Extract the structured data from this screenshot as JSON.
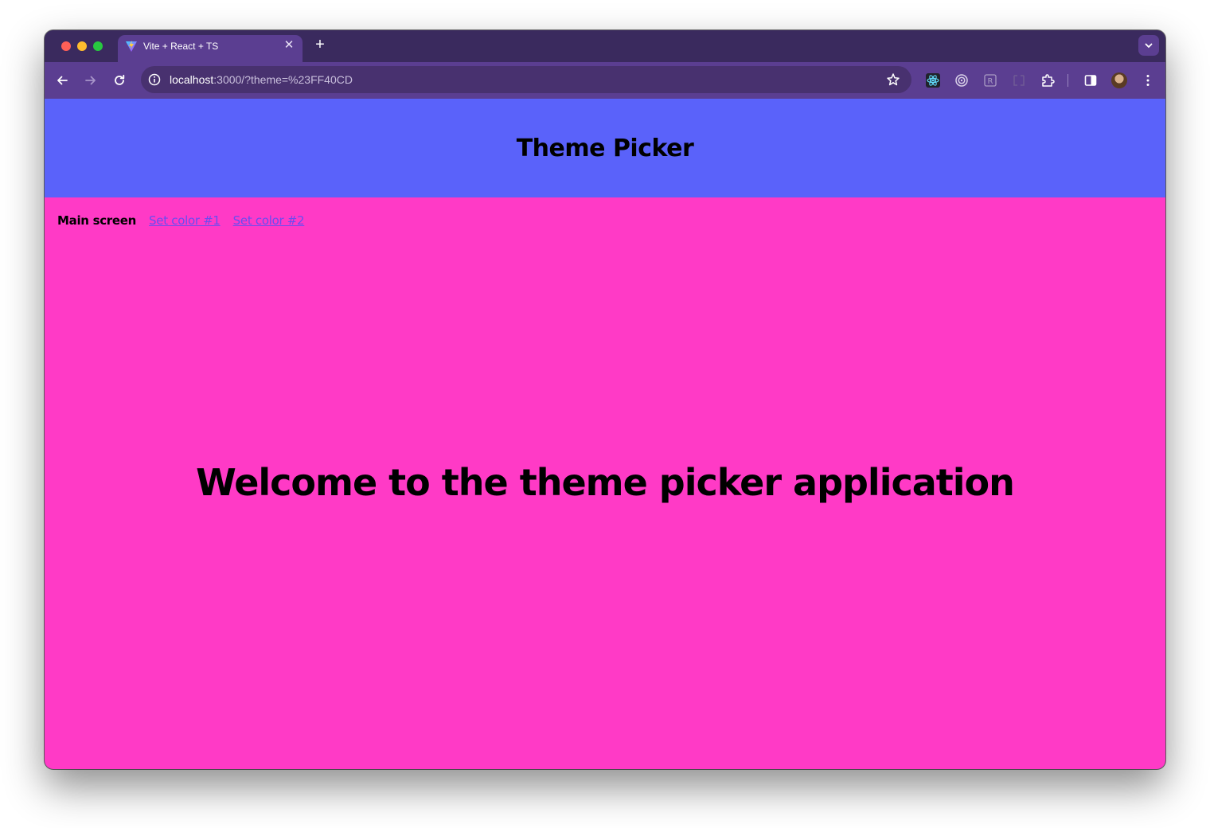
{
  "browser": {
    "tab": {
      "title": "Vite + React + TS",
      "favicon": "vite-logo-icon"
    },
    "url": {
      "host": "localhost",
      "rest": ":3000/?theme=%23FF40CD"
    },
    "colors": {
      "frame": "#3a2a5e",
      "toolbar": "#5b3e91",
      "omnibox": "#48316f"
    }
  },
  "app": {
    "title": "Theme Picker",
    "nav": {
      "current": "Main screen",
      "links": [
        "Set color #1",
        "Set color #2"
      ]
    },
    "welcome": "Welcome to the theme picker application",
    "colors": {
      "header": "#5a62fa",
      "background": "#ff3ac6",
      "link": "#6a4cf0"
    }
  }
}
